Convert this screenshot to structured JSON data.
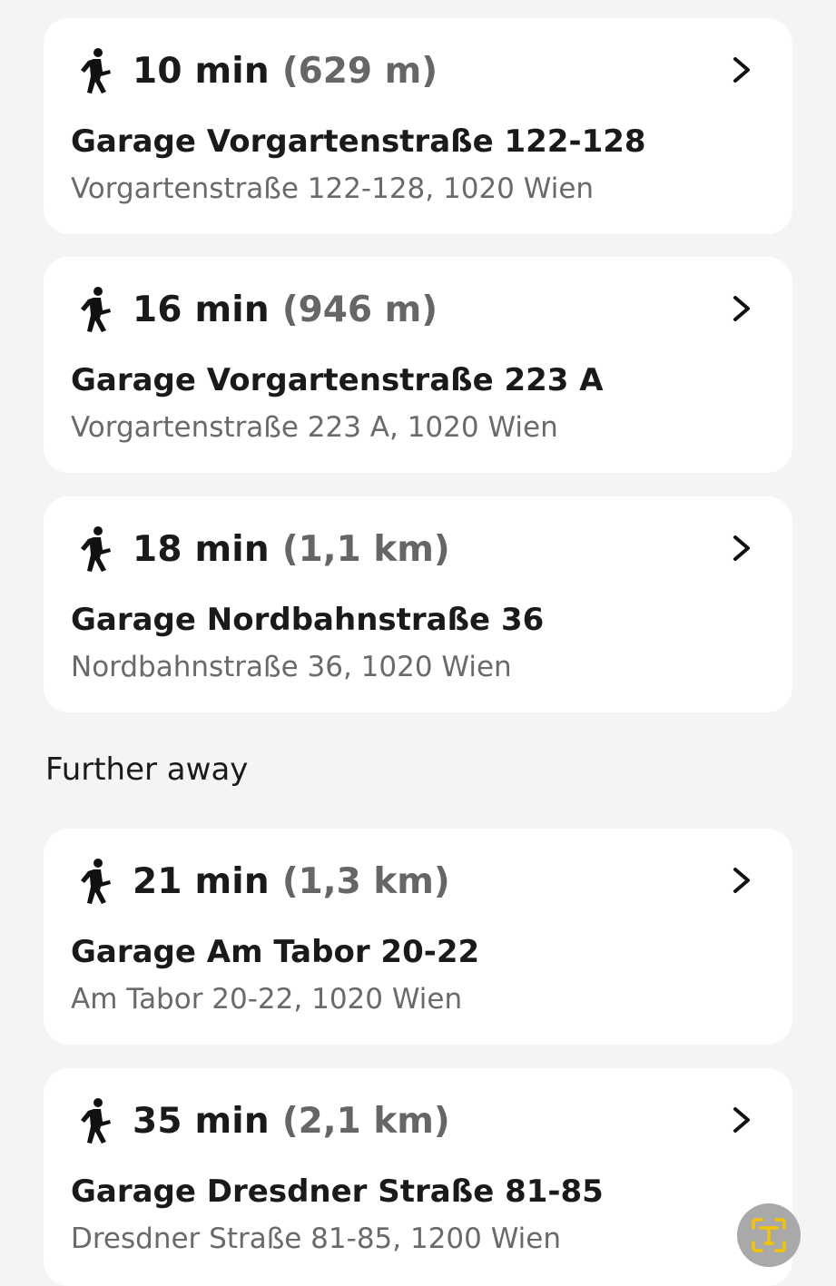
{
  "nearby": [
    {
      "duration": "10 min",
      "distance": "(629 m)",
      "name": "Garage Vorgartenstraße 122-128",
      "address": "Vorgartenstraße 122-128, 1020 Wien"
    },
    {
      "duration": "16 min",
      "distance": "(946 m)",
      "name": "Garage Vorgartenstraße 223 A",
      "address": "Vorgartenstraße 223 A, 1020 Wien"
    },
    {
      "duration": "18 min",
      "distance": "(1,1 km)",
      "name": "Garage Nordbahnstraße 36",
      "address": "Nordbahnstraße 36, 1020 Wien"
    }
  ],
  "further": {
    "title": "Further away",
    "items": [
      {
        "duration": "21 min",
        "distance": "(1,3 km)",
        "name": "Garage Am Tabor 20-22",
        "address": "Am Tabor 20-22, 1020 Wien"
      },
      {
        "duration": "35 min",
        "distance": "(2,1 km)",
        "name": "Garage Dresdner Straße 81-85",
        "address": "Dresdner Straße 81-85, 1200 Wien"
      }
    ]
  },
  "icons": {
    "walk": "walking-person-icon",
    "chevron": "chevron-right-icon",
    "fab": "text-scan-icon"
  },
  "colors": {
    "background": "#f4f4f4",
    "card": "#ffffff",
    "primary_text": "#1a1a1a",
    "secondary_text": "#6a6a6a",
    "fab_ring": "#f5c400",
    "fab_bg": "#a9a9a9"
  }
}
